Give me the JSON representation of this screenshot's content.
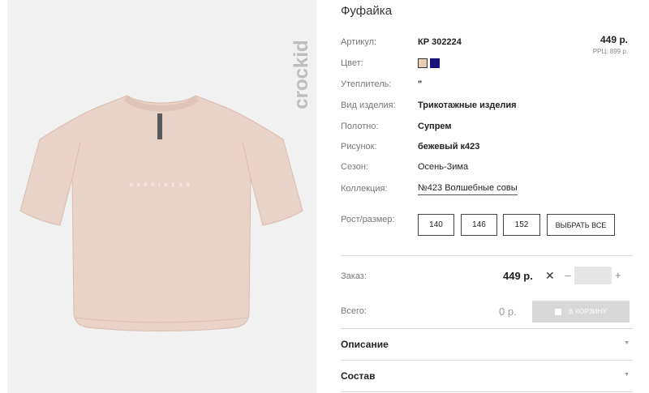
{
  "product": {
    "title": "Фуфайка",
    "brand": "crockid",
    "print_text": "HAPPINESS"
  },
  "price": {
    "value": "449 р.",
    "rrc": "РРЦ: 899 р."
  },
  "specs": [
    {
      "label": "Артикул:",
      "value": "КР 302224"
    },
    {
      "label": "Цвет:",
      "value": ""
    },
    {
      "label": "Утеплитель:",
      "value": "\""
    },
    {
      "label": "Вид изделия:",
      "value": "Трикотажные изделия"
    },
    {
      "label": "Полотно:",
      "value": "Супрем"
    },
    {
      "label": "Рисунок:",
      "value": "бежевый к423"
    },
    {
      "label": "Сезон:",
      "value": "Осень-Зима"
    },
    {
      "label": "Коллекция:",
      "value": "№423 Волшебные совы"
    }
  ],
  "colors": [
    "#e4cfb5",
    "#16137a"
  ],
  "sizes": {
    "label": "Рост/размер:",
    "options": [
      "140",
      "146",
      "152"
    ],
    "select_all": "ВЫБРАТЬ ВСЕ"
  },
  "order": {
    "label": "Заказ:",
    "price": "449 р.",
    "times": "✕",
    "minus": "–",
    "plus": "+",
    "quantity": ""
  },
  "total": {
    "label": "Всего:",
    "value": "0 р.",
    "cart_button": "В КОРЗИНУ"
  },
  "accordions": [
    {
      "label": "Описание"
    },
    {
      "label": "Состав"
    }
  ]
}
